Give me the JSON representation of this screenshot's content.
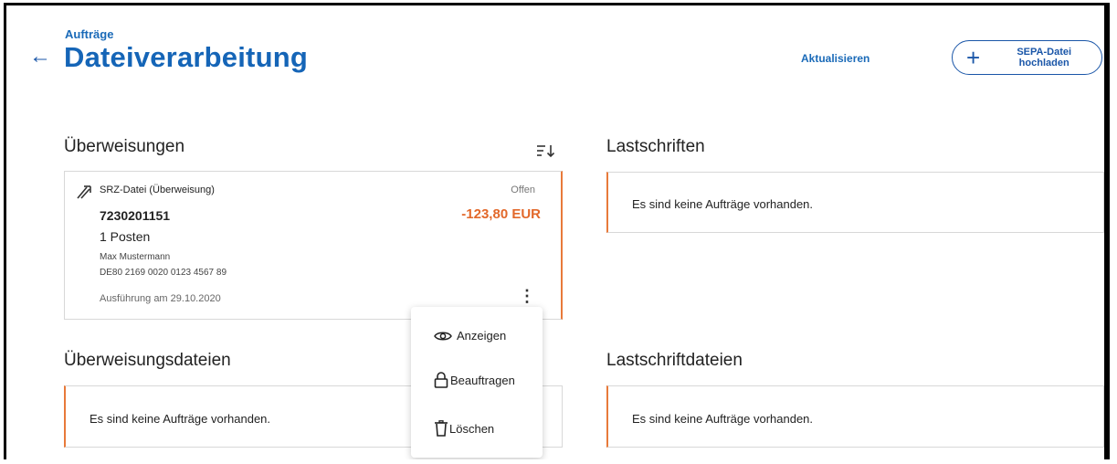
{
  "header": {
    "breadcrumb": "Aufträge",
    "title": "Dateiverarbeitung",
    "refresh_label": "Aktualisieren",
    "upload_label_line1": "SEPA-Datei",
    "upload_label_line2": "hochladen"
  },
  "transfers": {
    "heading": "Überweisungen",
    "card": {
      "type": "SRZ-Datei (Überweisung)",
      "status": "Offen",
      "number": "7230201151",
      "amount": "-123,80 EUR",
      "count": "1 Posten",
      "name": "Max Mustermann",
      "iban": "DE80 2169 0020 0123 4567 89",
      "execution": "Ausführung am 29.10.2020"
    }
  },
  "direct_debits": {
    "heading": "Lastschriften",
    "empty": "Es sind keine Aufträge vorhanden."
  },
  "transfer_files": {
    "heading": "Überweisungsdateien",
    "empty": "Es sind keine Aufträge vorhanden."
  },
  "debit_files": {
    "heading": "Lastschriftdateien",
    "empty": "Es sind keine Aufträge vorhanden."
  },
  "context_menu": {
    "items": [
      {
        "label": "Anzeigen",
        "icon": "eye-icon"
      },
      {
        "label": "Beauftragen",
        "icon": "lock-icon"
      },
      {
        "label": "Löschen",
        "icon": "trash-icon"
      }
    ]
  },
  "colors": {
    "primary": "#1565b7",
    "accent": "#e87a3a",
    "amount": "#e2682a"
  }
}
